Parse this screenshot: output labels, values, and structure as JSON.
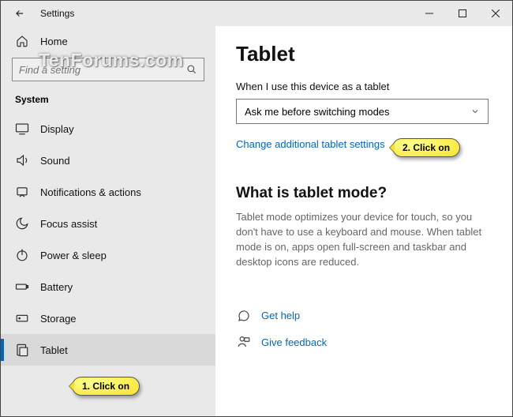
{
  "titlebar": {
    "title": "Settings"
  },
  "sidebar": {
    "home": "Home",
    "search_placeholder": "Find a setting",
    "section": "System",
    "items": [
      {
        "label": "Display"
      },
      {
        "label": "Sound"
      },
      {
        "label": "Notifications & actions"
      },
      {
        "label": "Focus assist"
      },
      {
        "label": "Power & sleep"
      },
      {
        "label": "Battery"
      },
      {
        "label": "Storage"
      },
      {
        "label": "Tablet"
      }
    ]
  },
  "main": {
    "heading": "Tablet",
    "field_label": "When I use this device as a tablet",
    "dropdown_value": "Ask me before switching modes",
    "change_link": "Change additional tablet settings",
    "section_title": "What is tablet mode?",
    "description": "Tablet mode optimizes your device for touch, so you don't have to use a keyboard and mouse. When tablet mode is on, apps open full-screen and taskbar and desktop icons are reduced.",
    "get_help": "Get help",
    "feedback": "Give feedback"
  },
  "callouts": {
    "one": "1. Click on",
    "two": "2. Click on"
  },
  "watermark": "TenForums.com"
}
